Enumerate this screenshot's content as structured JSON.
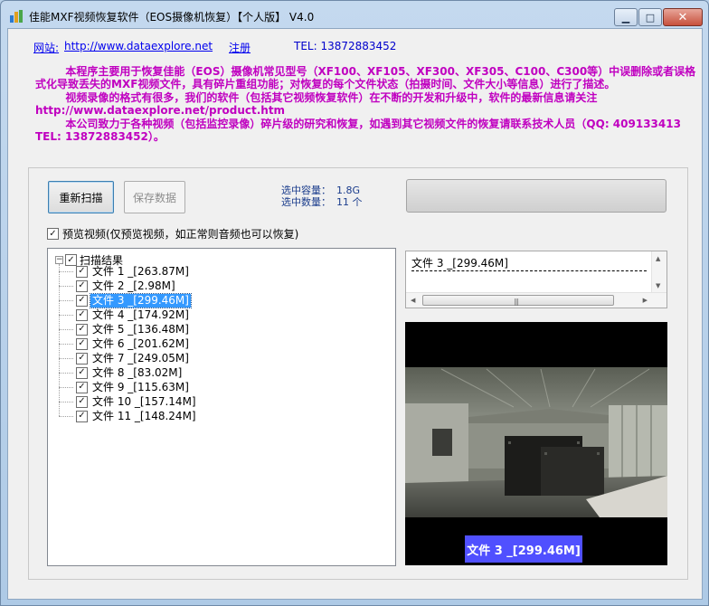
{
  "window": {
    "title": "佳能MXF视频恢复软件（EOS摄像机恢复）【个人版】 V4.0",
    "controls": {
      "minimize": "▁",
      "maximize": "□",
      "close": "✕"
    }
  },
  "links": {
    "site_label": "网站:",
    "site_url": "http://www.dataexplore.net",
    "register": "注册",
    "tel": "TEL: 13872883452"
  },
  "description": [
    "        本程序主要用于恢复佳能（EOS）摄像机常见型号（XF100、XF105、XF300、XF305、C100、C300等）中误删除或者误格式化导致丢失的MXF视频文件，具有碎片重组功能；对恢复的每个文件状态（拍摄时间、文件大小等信息）进行了描述。",
    "        视频录像的格式有很多，我们的软件（包括其它视频恢复软件）在不断的开发和升级中，软件的最新信息请关注http://www.dataexplore.net/product.htm",
    "        本公司致力于各种视频（包括监控录像）碎片级的研究和恢复，如遇到其它视频文件的恢复请联系技术人员（QQ: 409133413  TEL: 13872883452）。"
  ],
  "toolbar": {
    "rescan": "重新扫描",
    "save": "保存数据"
  },
  "stats": {
    "capacity_label": "选中容量：",
    "capacity_value": "1.8G",
    "count_label": "选中数量：",
    "count_value": "11 个"
  },
  "preview": {
    "checkbox_label": "预览视频(仅预览视频，如正常则音频也可以恢复)",
    "checked": true
  },
  "tree": {
    "root_label": "扫描结果",
    "items": [
      {
        "label": "文件 1 _[263.87M]",
        "checked": true
      },
      {
        "label": "文件 2 _[2.98M]",
        "checked": true
      },
      {
        "label": "文件 3 _[299.46M]",
        "checked": true,
        "selected": true
      },
      {
        "label": "文件 4 _[174.92M]",
        "checked": true
      },
      {
        "label": "文件 5 _[136.48M]",
        "checked": true
      },
      {
        "label": "文件 6 _[201.62M]",
        "checked": true
      },
      {
        "label": "文件 7 _[249.05M]",
        "checked": true
      },
      {
        "label": "文件 8 _[83.02M]",
        "checked": true
      },
      {
        "label": "文件 9 _[115.63M]",
        "checked": true
      },
      {
        "label": "文件 10 _[157.14M]",
        "checked": true
      },
      {
        "label": "文件 11 _[148.24M]",
        "checked": true
      }
    ]
  },
  "info": {
    "text": "文件 3 _[299.46M]"
  },
  "video": {
    "caption": "文件 3 _[299.46M]"
  },
  "colors": {
    "description": "#c000c0",
    "link": "#0000ee",
    "stats": "#1a3c8c",
    "caption_bg": "#5050ff",
    "selection": "#3399ff"
  }
}
